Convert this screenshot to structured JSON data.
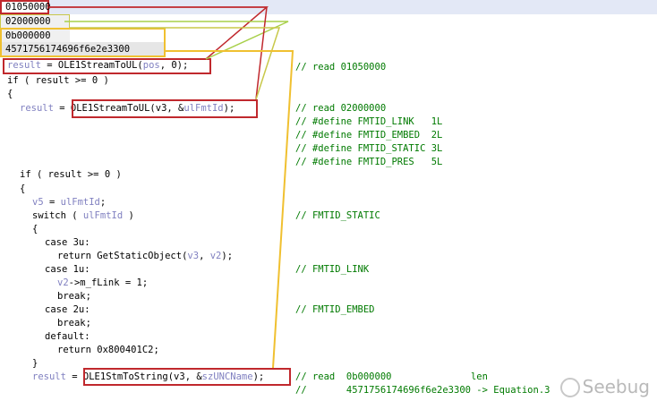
{
  "hex_values": [
    "01050000",
    "02000000",
    "0b000000",
    "4571756174696f6e2e3300"
  ],
  "code": {
    "line1": {
      "a": "result",
      "b": " = ",
      "c": "OLE1StreamToUL",
      "d": "(",
      "e": "pos",
      "f": ", 0);"
    },
    "line2": "if ( result >= 0 )",
    "line3": "{",
    "line4": {
      "a": "result",
      "b": " = ",
      "c": "OLE1StreamToUL",
      "d": "(v3, &",
      "e": "ulFmtId",
      "f": ");"
    },
    "line5": "if ( result >= 0 )",
    "line6": "{",
    "line7": {
      "a": "v5",
      "b": " = ",
      "c": "ulFmtId",
      "d": ";"
    },
    "line8": {
      "a": "switch ( ",
      "b": "ulFmtId",
      "c": " )"
    },
    "line9": "{",
    "line10": "case 3u:",
    "line11": {
      "a": "return GetStaticObject(",
      "b": "v3",
      "c": ", ",
      "d": "v2",
      "e": ");"
    },
    "line12": "case 1u:",
    "line13": {
      "a": "v2",
      "b": "->m_fLink = 1;"
    },
    "line14": "break;",
    "line15": "case 2u:",
    "line16": "break;",
    "line17": "default:",
    "line18": "return 0x800401C2;",
    "line19": "}",
    "line20": {
      "a": "result",
      "b": " = ",
      "c": "OLE1StmToString",
      "d": "(v3, &",
      "e": "szUNCName",
      "f": ");"
    }
  },
  "comments": {
    "c1": "// read 01050000",
    "c2": "// read 02000000",
    "c3": "// #define FMTID_LINK   1L",
    "c4": "// #define FMTID_EMBED  2L",
    "c5": "// #define FMTID_STATIC 3L",
    "c6": "// #define FMTID_PRES   5L",
    "c7": "// FMTID_STATIC",
    "c8": "// FMTID_LINK",
    "c9": "// FMTID_EMBED",
    "c10": "// read  0b000000              len",
    "c11": "//       4571756174696f6e2e3300 -> Equation.3"
  },
  "watermark": "Seebug",
  "colors": {
    "red": "#c0282d",
    "green": "#a8d04a",
    "olive": "#c8c84a",
    "gold": "#f0c030",
    "hexbg": "#dfe6f7"
  }
}
